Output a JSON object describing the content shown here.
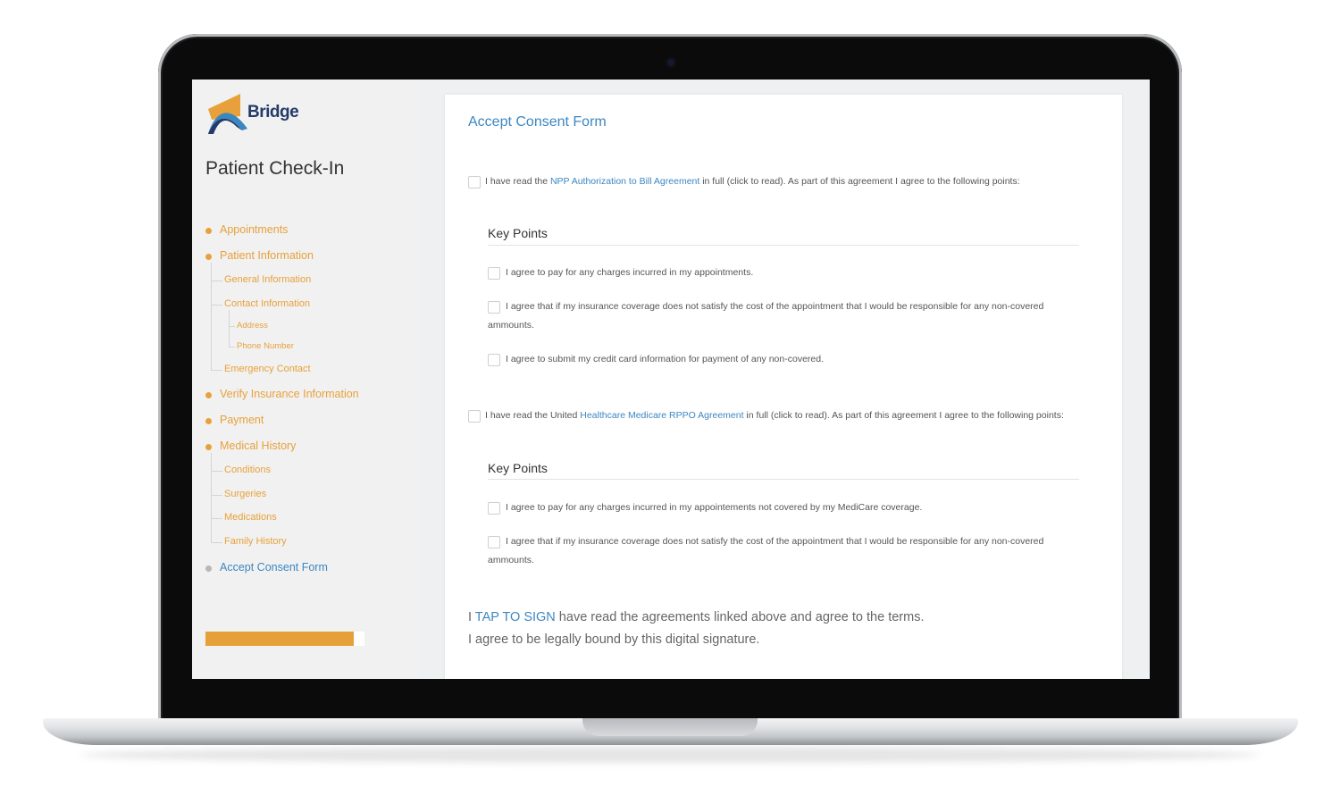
{
  "brand": {
    "name": "Bridge",
    "accent": "#3d87c1",
    "nav_color": "#e8a13a"
  },
  "sidebar": {
    "title": "Patient Check-In",
    "nav": {
      "appointments": "Appointments",
      "patient_information": "Patient Information",
      "general_information": "General Information",
      "contact_information": "Contact Information",
      "address": "Address",
      "phone_number": "Phone Number",
      "emergency_contact": "Emergency Contact",
      "verify_insurance": "Verify Insurance Information",
      "payment": "Payment",
      "medical_history": "Medical History",
      "conditions": "Conditions",
      "surgeries": "Surgeries",
      "medications": "Medications",
      "family_history": "Family History",
      "accept_consent": "Accept Consent Form"
    },
    "progress": 0.93
  },
  "main": {
    "title": "Accept Consent Form",
    "agreement1": {
      "prefix": "I have read the ",
      "link": "NPP Authorization to Bill Agreement",
      "suffix": " in full (click to read).  As part of this agreement I agree to the following points:",
      "key_points_title": "Key Points",
      "points": [
        "I agree to pay for any charges incurred in my appointments.",
        "I agree that if my insurance coverage does not satisfy the cost of the appointment that I would be responsible for any non-covered ammounts.",
        "I agree to submit my credit card information for payment of any non-covered."
      ]
    },
    "agreement2": {
      "prefix": "I have read the United ",
      "link": "Healthcare Medicare RPPO Agreement",
      "suffix": " in full (click to read).  As part of this agreement I agree to the following points:",
      "key_points_title": "Key Points",
      "points": [
        "I agree to pay for any charges incurred in my appointements not covered by my MediCare coverage.",
        "I agree that if my insurance coverage does not satisfy the cost of the appointment that I would be responsible for any non-covered ammounts."
      ]
    },
    "signature": {
      "prefix": "I ",
      "tap_to_sign": "TAP TO SIGN",
      "suffix": " have read the agreements linked above and agree to the terms.",
      "line2": "I agree to be legally bound by this digital signature."
    }
  }
}
